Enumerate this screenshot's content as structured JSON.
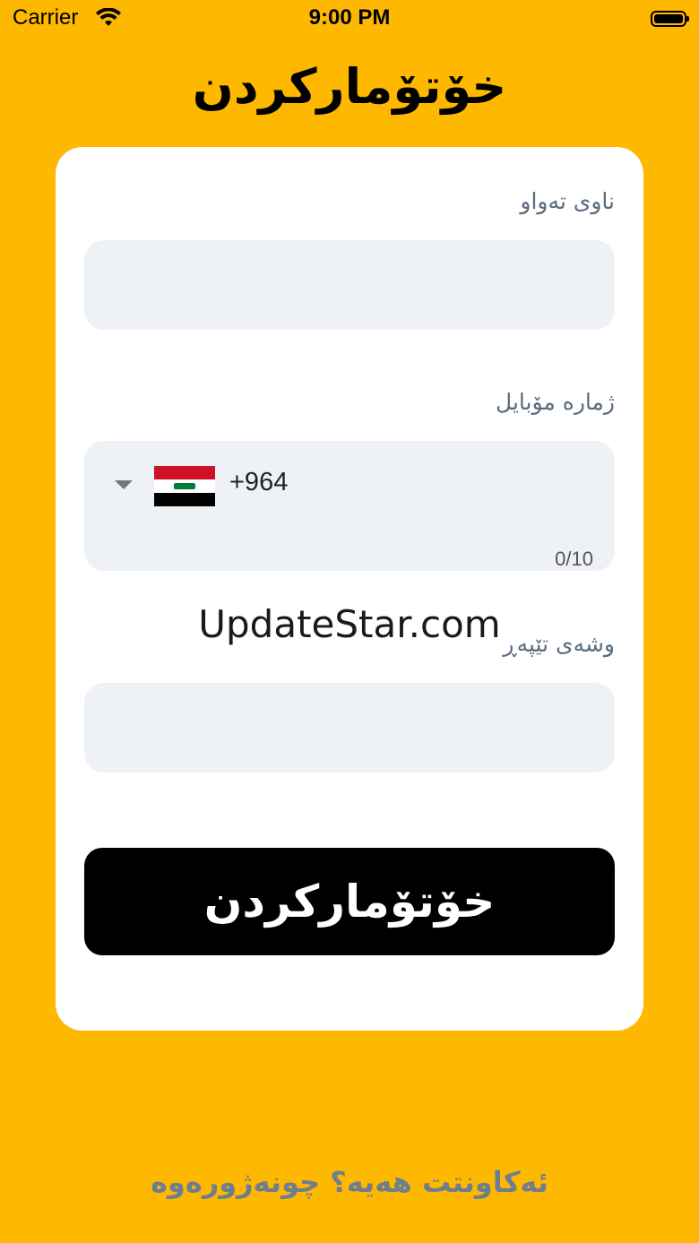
{
  "status_bar": {
    "carrier": "Carrier",
    "time": "9:00 PM",
    "wifi_icon": "wifi-icon",
    "battery_icon": "battery-icon"
  },
  "title": "خۆتۆمارکردن",
  "form": {
    "full_name": {
      "label": "ناوی تەواو",
      "value": ""
    },
    "mobile": {
      "label": "ژمارە مۆبایل",
      "country_flag": "iraq-flag-icon",
      "dial_code": "+964",
      "value": "",
      "counter": "0/10"
    },
    "password": {
      "label": "وشەی تێپەڕ",
      "value": ""
    },
    "submit_label": "خۆتۆمارکردن"
  },
  "watermark": "UpdateStar.com",
  "login_link": "ئەکاونتت هەیە؟ چونەژورەوە",
  "colors": {
    "background": "#FFB800",
    "card": "#FFFFFF",
    "input": "#EEF1F5",
    "button": "#000000",
    "label": "#5B6B80"
  }
}
